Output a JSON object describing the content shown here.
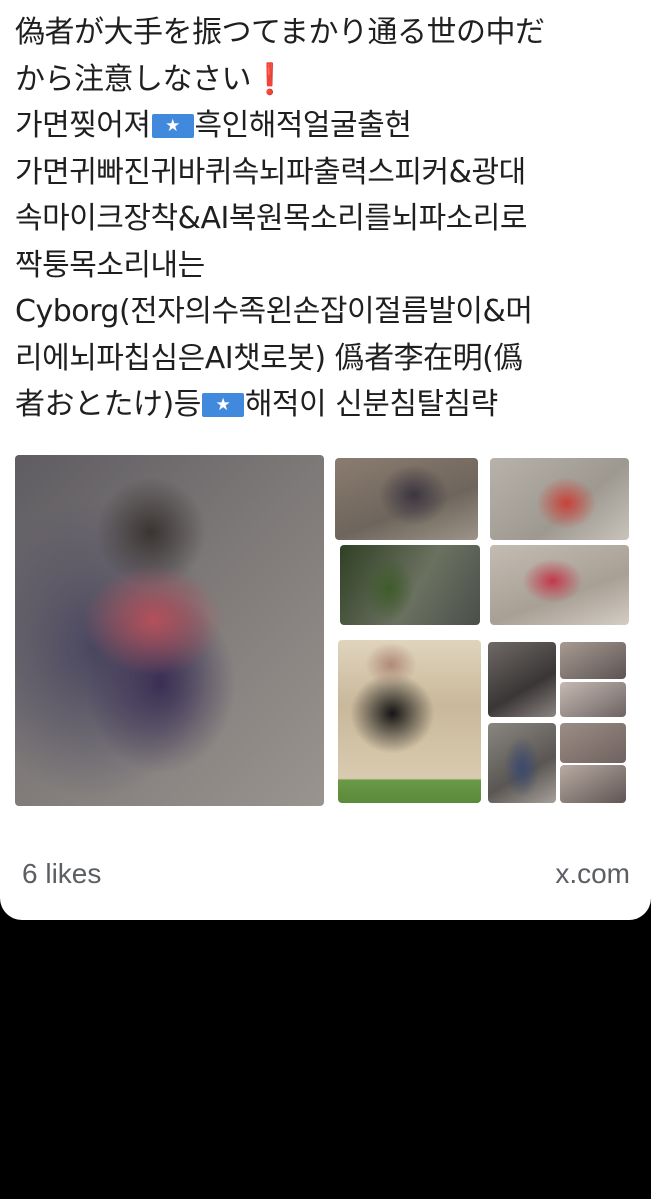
{
  "post": {
    "lines": [
      "偽者が大手を振つてまかり通る世の中だ",
      "から注意しなさい",
      "흑인해적얼굴출현",
      "가면귀빠진귀바퀴속뇌파출력스피커&광대",
      "속마이크장착&AI복원목소리를뇌파소리로",
      "짝퉁목소리내는",
      "Cyborg(전자의수족왼손잡이절름발이&머",
      "리에뇌파칩심은AI챗로봇) 僞者李在明(僞",
      "者おとたけ)등",
      "해적이 신분침탈침략"
    ],
    "line3_prefix": "가면찢어져",
    "exclaim": "❗",
    "flag_icon": "somalia-flag-icon"
  },
  "images": [
    "blurred-person-photo",
    "person-photo",
    "person-red-shirt-photo",
    "person-outdoors-photo",
    "person-kneeling-photo",
    "person-standing-photo",
    "person-photo-small-1",
    "person-photo-small-2",
    "person-photo-small-3",
    "person-photo-small-4",
    "person-photo-small-5",
    "person-photo-small-6"
  ],
  "footer": {
    "likes": "6 likes",
    "source": "x.com"
  },
  "colors": {
    "background": "#000000",
    "card": "#ffffff",
    "text": "#1f1f1f",
    "muted": "#5b5e63",
    "flag_blue": "#4189dd",
    "exclaim_red": "#e0202b"
  }
}
